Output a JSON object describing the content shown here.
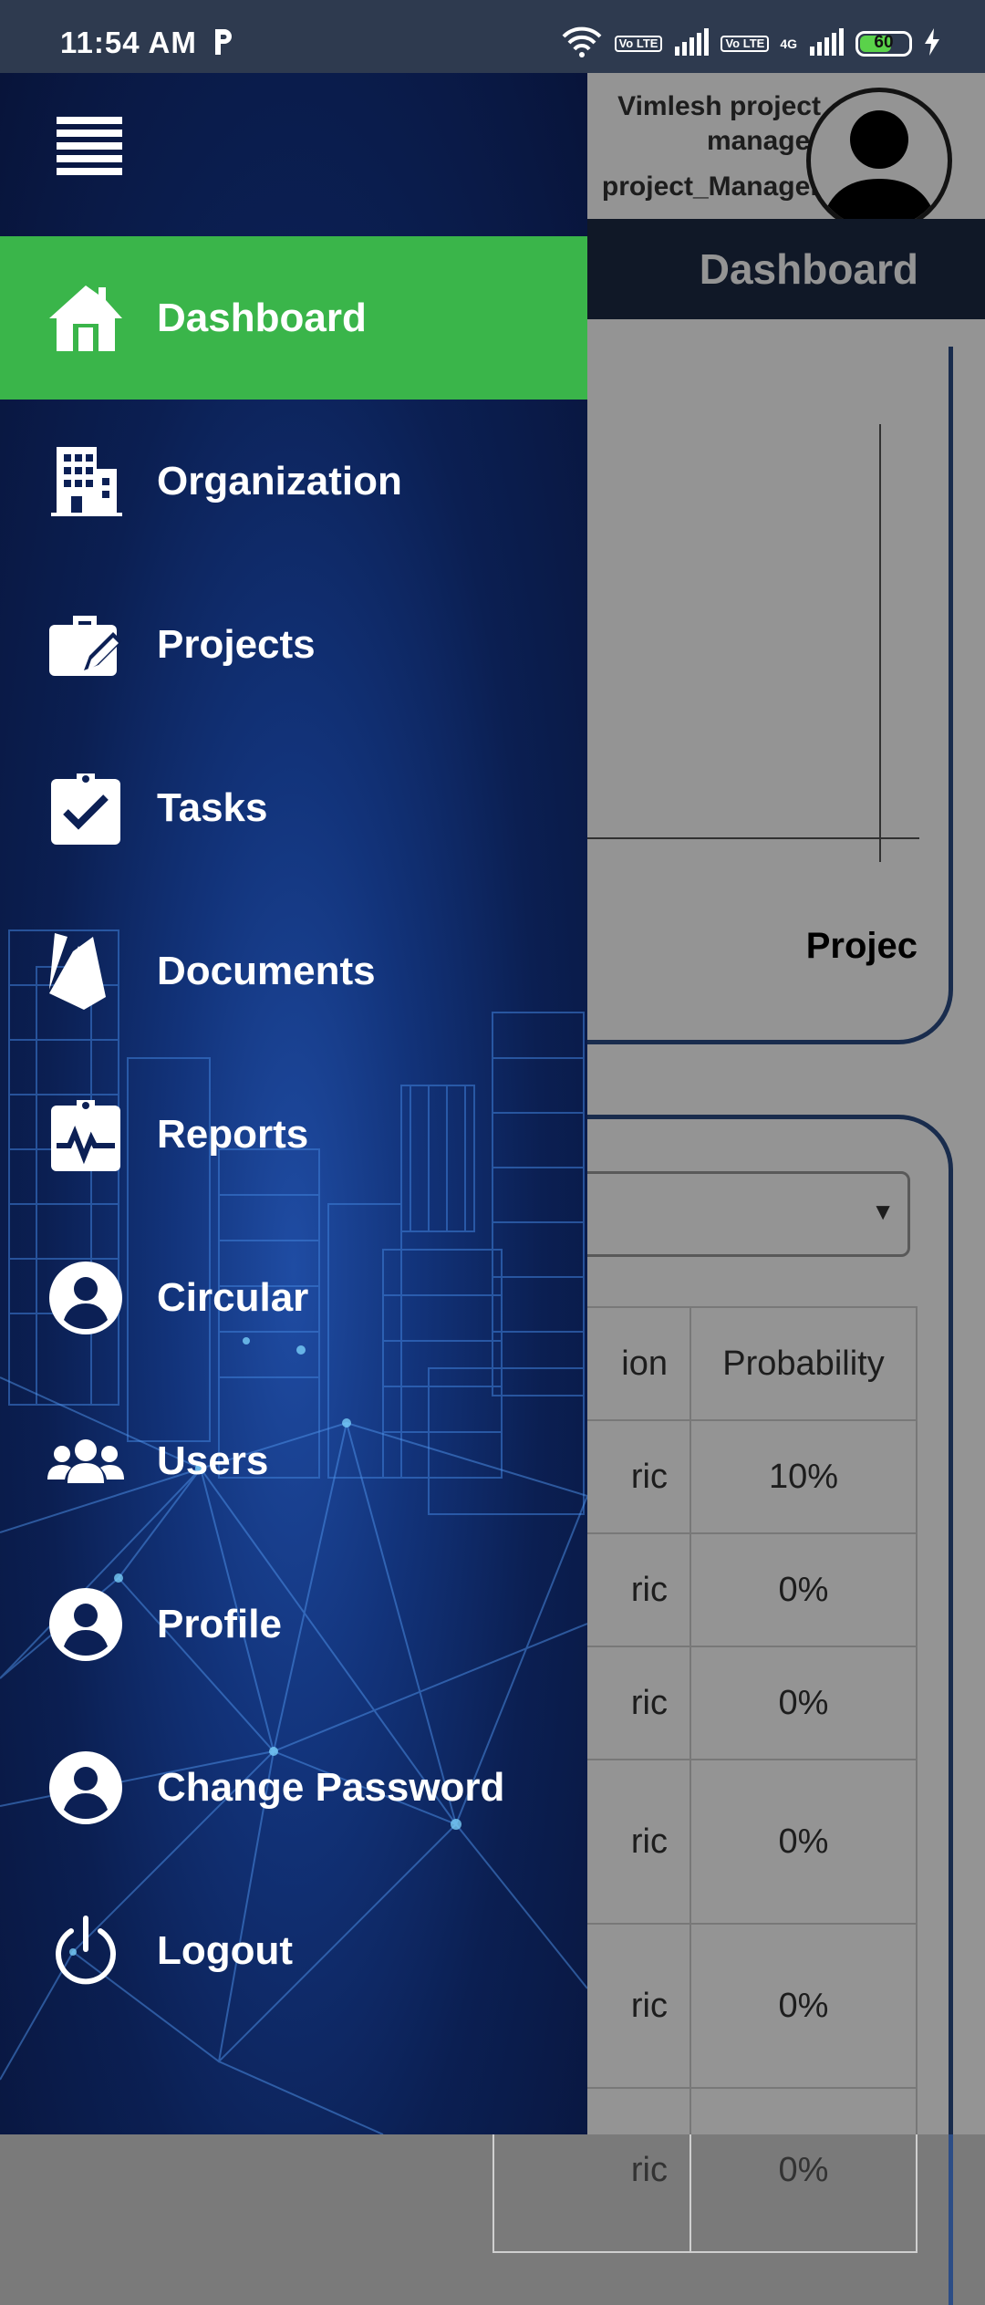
{
  "status_bar": {
    "time": "11:54 AM",
    "lte_1": "Vo LTE",
    "lte_2": "Vo LTE",
    "net": "4G",
    "battery": "60"
  },
  "header": {
    "user_name": "Vimlesh project manager",
    "user_role": "project_Manager",
    "page_title": "Dashboard"
  },
  "chart_card": {
    "label": "Projec"
  },
  "table": {
    "header": [
      "ion",
      "Probability"
    ],
    "rows": [
      [
        "ric",
        "10%"
      ],
      [
        "ric",
        "0%"
      ],
      [
        "ric",
        "0%"
      ],
      [
        "ric",
        "0%"
      ],
      [
        "ric",
        "0%"
      ],
      [
        "ric",
        "0%"
      ]
    ]
  },
  "drawer": {
    "menu_icon": "hamburger-icon",
    "active_item": "Dashboard",
    "active_color": "#3ab54a",
    "items": [
      {
        "label": "Dashboard",
        "icon": "home-icon"
      },
      {
        "label": "Organization",
        "icon": "building-icon"
      },
      {
        "label": "Projects",
        "icon": "briefcase-edit-icon"
      },
      {
        "label": "Tasks",
        "icon": "clipboard-check-icon"
      },
      {
        "label": "Documents",
        "icon": "firebase-documents-icon"
      },
      {
        "label": "Reports",
        "icon": "clipboard-pulse-icon"
      },
      {
        "label": "Circular",
        "icon": "user-circle-icon"
      },
      {
        "label": "Users",
        "icon": "users-group-icon"
      },
      {
        "label": "Profile",
        "icon": "user-circle-icon"
      },
      {
        "label": "Change Password",
        "icon": "user-circle-icon"
      },
      {
        "label": "Logout",
        "icon": "power-icon"
      }
    ]
  }
}
